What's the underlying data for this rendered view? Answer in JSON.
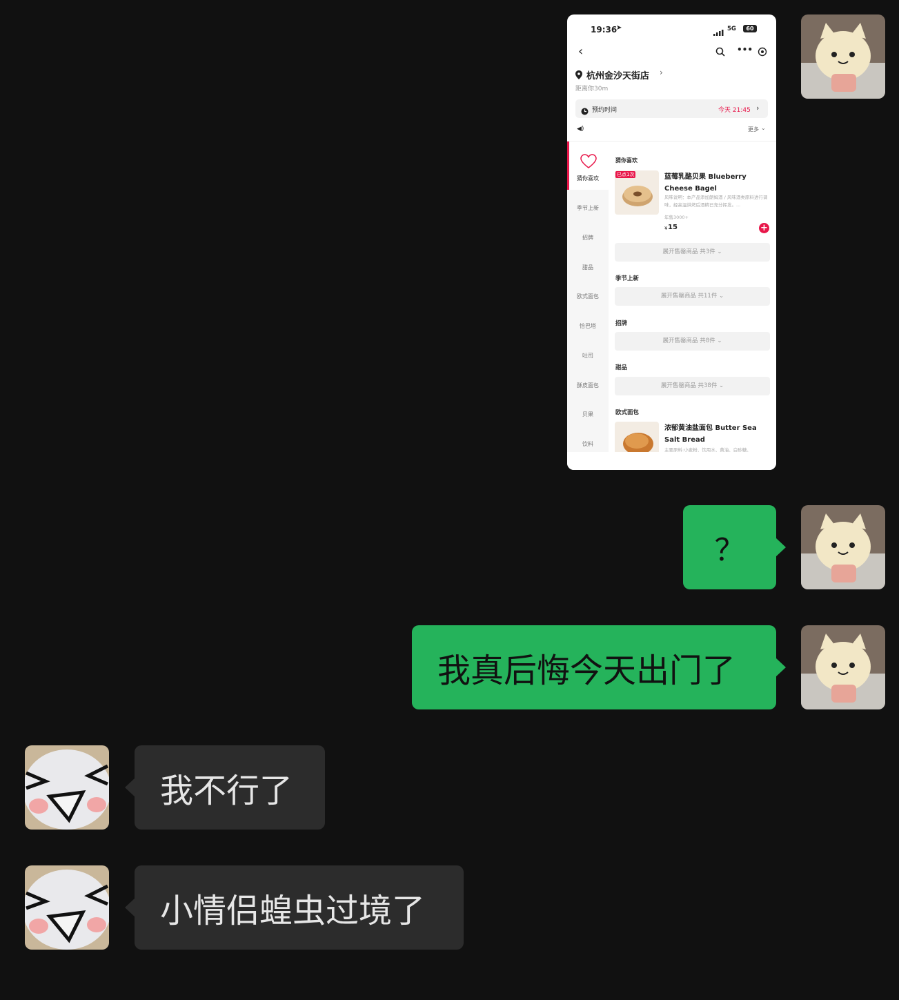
{
  "shot": {
    "status_time": "19:36",
    "status_network": "5G",
    "status_battery": "60",
    "store_name": "杭州金沙天街店",
    "store_distance": "距离你30m",
    "reserve_label": "预约时间",
    "reserve_value": "今天 21:45",
    "more_label": "更多",
    "categories": [
      "猜你喜欢",
      "季节上新",
      "招牌",
      "甜品",
      "欧式面包",
      "恰巴塔",
      "吐司",
      "酥皮面包",
      "贝果",
      "饮料"
    ],
    "section_guess": "猜你喜欢",
    "product1_badge": "已点1次",
    "product1_name": "蓝莓乳酪贝果 Blueberry Cheese Bagel",
    "product1_desc": "风味说明：本产品添加朗姆酒 / 风味酒类原料进行调味，经高温烘烤后酒精已充分挥发。...",
    "product1_sales": "年售3000+",
    "product1_price": "15",
    "expand1": "展开售罄商品  共3件",
    "section_season": "季节上新",
    "expand2": "展开售罄商品  共11件",
    "section_sign": "招牌",
    "expand3": "展开售罄商品  共8件",
    "section_dessert": "甜品",
    "expand4": "展开售罄商品  共38件",
    "section_euro": "欧式面包",
    "product2_name": "浓郁黄油盐面包 Butter Sea Salt Bread",
    "product2_desc": "主要原料:小麦粉、饮用水、黄油、白砂糖、"
  },
  "messages": {
    "me_question": "？",
    "me_regret": "我真后悔今天出门了",
    "other_1": "我不行了",
    "other_2": "小情侣蝗虫过境了"
  },
  "colors": {
    "me_bubble": "#25b35b",
    "other_bubble": "#2c2c2c",
    "background": "#111111",
    "accent_red": "#e8174a"
  }
}
